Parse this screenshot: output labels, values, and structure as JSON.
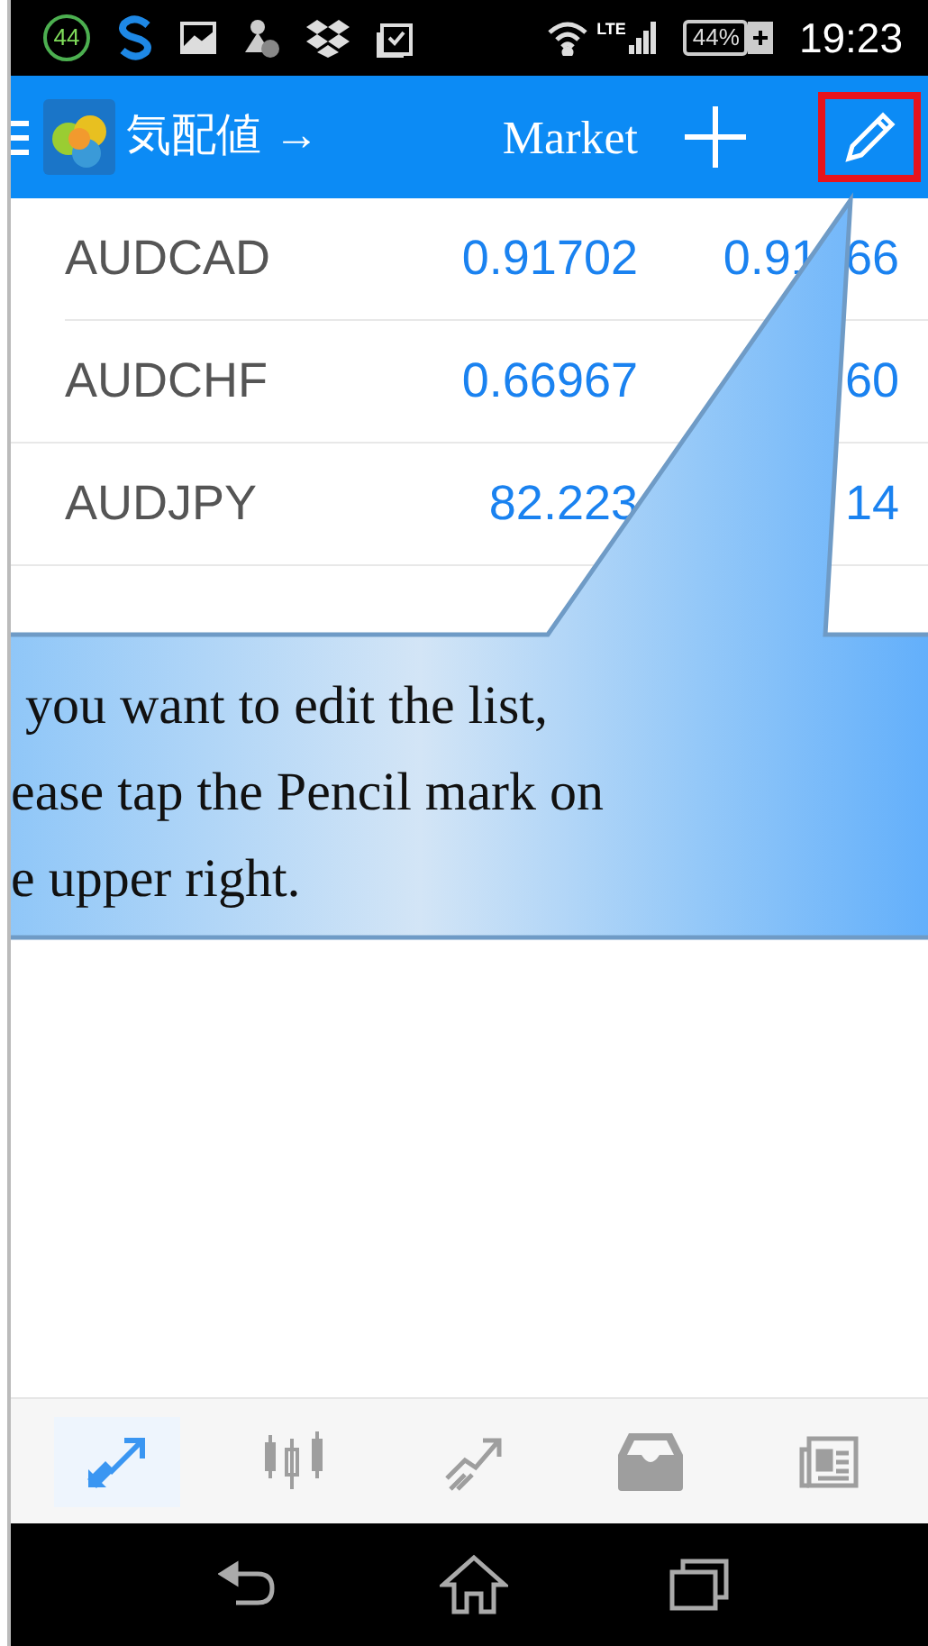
{
  "status_bar": {
    "badge": "44",
    "network": "LTE",
    "battery": "44%",
    "time": "19:23"
  },
  "header": {
    "title": "気配値 →",
    "subtitle": "Market"
  },
  "quotes": [
    {
      "symbol": "AUDCAD",
      "bid": "0.91702",
      "ask_parts": [
        "0.91",
        "66"
      ]
    },
    {
      "symbol": "AUDCHF",
      "bid": "0.66967",
      "ask_parts": [
        "60"
      ]
    },
    {
      "symbol": "AUDJPY",
      "bid": "82.223",
      "ask_parts": [
        "14"
      ]
    }
  ],
  "callout": {
    "lines": [
      "you want to edit the list,",
      "ease tap the Pencil mark on",
      "e upper right."
    ]
  },
  "bottom_nav": [
    {
      "kind": "quotes",
      "selected": true
    },
    {
      "kind": "chart",
      "selected": false
    },
    {
      "kind": "trade",
      "selected": false
    },
    {
      "kind": "mailbox",
      "selected": false
    },
    {
      "kind": "news",
      "selected": false
    }
  ]
}
